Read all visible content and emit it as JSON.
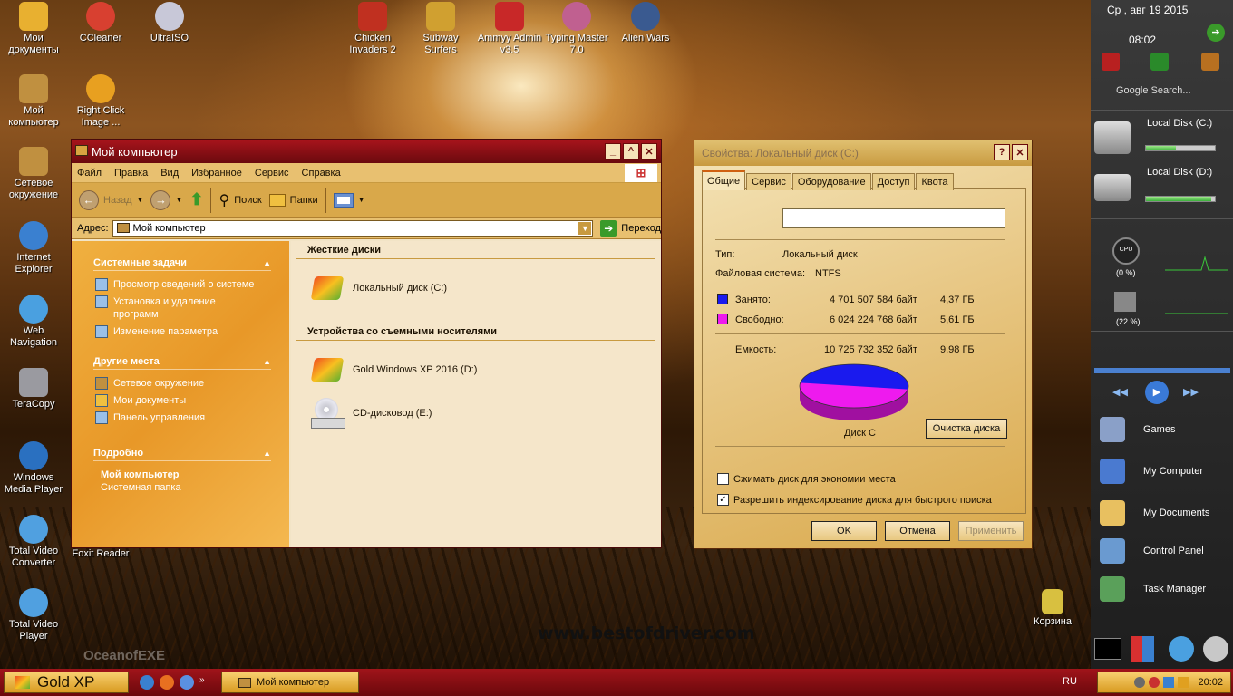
{
  "desktop": {
    "icons": [
      {
        "label": "Мои документы",
        "color": "#e8b030"
      },
      {
        "label": "CCleaner",
        "color": "#d84030"
      },
      {
        "label": "UltraISO",
        "color": "#c8c8d8"
      },
      {
        "label": "Мой компьютер",
        "color": "#c09040"
      },
      {
        "label": "Right Click Image ...",
        "color": "#e8a020"
      },
      {
        "label": "Сетевое окружение",
        "color": "#c09040"
      },
      {
        "label": "Internet Explorer",
        "color": "#3a80d0"
      },
      {
        "label": "Web Navigation",
        "color": "#4aa0e0"
      },
      {
        "label": "TeraCopy",
        "color": "#9a9aa0"
      },
      {
        "label": "Windows Media Player",
        "color": "#2a70c0"
      },
      {
        "label": "Total Video Converter",
        "color": "#50a0e0"
      },
      {
        "label": "Total Video Player",
        "color": "#50a0e0"
      },
      {
        "label": "Foxit Reader",
        "color": "#6a4a10"
      },
      {
        "label": "Chicken Invaders 2",
        "color": "#c03020"
      },
      {
        "label": "Subway Surfers",
        "color": "#d0a030"
      },
      {
        "label": "Ammyy Admin v3.5",
        "color": "#c82828"
      },
      {
        "label": "Typing Master 7.0",
        "color": "#c06090"
      },
      {
        "label": "Alien Wars",
        "color": "#3a5a90"
      },
      {
        "label": "Корзина",
        "color": "#d8c040"
      }
    ],
    "watermark": "OceanofEXE"
  },
  "explorer": {
    "title": "Мой компьютер",
    "menu": [
      "Файл",
      "Правка",
      "Вид",
      "Избранное",
      "Сервис",
      "Справка"
    ],
    "toolbar": {
      "back": "Назад",
      "search": "Поиск",
      "folders": "Папки"
    },
    "address": {
      "label": "Адрес:",
      "value": "Мой компьютер",
      "go": "Переход"
    },
    "sidebar": {
      "system_tasks": {
        "title": "Системные задачи",
        "items": [
          "Просмотр сведений о системе",
          "Установка и удаление программ",
          "Изменение параметра"
        ]
      },
      "other_places": {
        "title": "Другие места",
        "items": [
          "Сетевое окружение",
          "Мои документы",
          "Панель управления"
        ]
      },
      "details": {
        "title": "Подробно",
        "name": "Мой компьютер",
        "type": "Системная папка"
      }
    },
    "groups": {
      "hard_disks": "Жесткие диски",
      "removable": "Устройства со съемными носителями"
    },
    "drives": {
      "c": "Локальный диск (C:)",
      "d": "Gold Windows XP 2016 (D:)",
      "e": "CD-дисковод (E:)"
    },
    "site": "www.bestofdriver.com"
  },
  "properties": {
    "title": "Свойства: Локальный диск (C:)",
    "tabs": [
      "Общие",
      "Сервис",
      "Оборудование",
      "Доступ",
      "Квота"
    ],
    "name_value": "",
    "type_label": "Тип:",
    "type_value": "Локальный диск",
    "fs_label": "Файловая система:",
    "fs_value": "NTFS",
    "used_label": "Занято:",
    "used_bytes": "4 701 507 584 байт",
    "used_gb": "4,37 ГБ",
    "free_label": "Свободно:",
    "free_bytes": "6 024 224 768 байт",
    "free_gb": "5,61 ГБ",
    "cap_label": "Емкость:",
    "cap_bytes": "10 725 732 352 байт",
    "cap_gb": "9,98 ГБ",
    "used_color": "#1a1aee",
    "free_color": "#ee1aee",
    "used_fraction": 0.438,
    "disk_label": "Диск C",
    "cleanup": "Очистка диска",
    "compress": "Сжимать диск для экономии места",
    "compress_checked": false,
    "index": "Разрешить индексирование диска для быстрого поиска",
    "index_checked": true,
    "ok": "OK",
    "cancel": "Отмена",
    "apply": "Применить"
  },
  "sidebar_gadgets": {
    "date": "Ср , авг 19 2015",
    "time": "08:02",
    "search": "Google Search...",
    "disk_c": "Local Disk (C:)",
    "disk_d": "Local Disk (D:)",
    "disk_c_fill": 0.44,
    "disk_d_fill": 0.95,
    "cpu": "CPU",
    "cpu_pct": "(0 %)",
    "ram_pct": "(22 %)",
    "links": [
      "Games",
      "My Computer",
      "My Documents",
      "Control Panel",
      "Task Manager"
    ]
  },
  "taskbar": {
    "start": "Gold XP",
    "active_app": "Мой компьютер",
    "lang": "RU",
    "clock": "20:02",
    "more": "»"
  }
}
